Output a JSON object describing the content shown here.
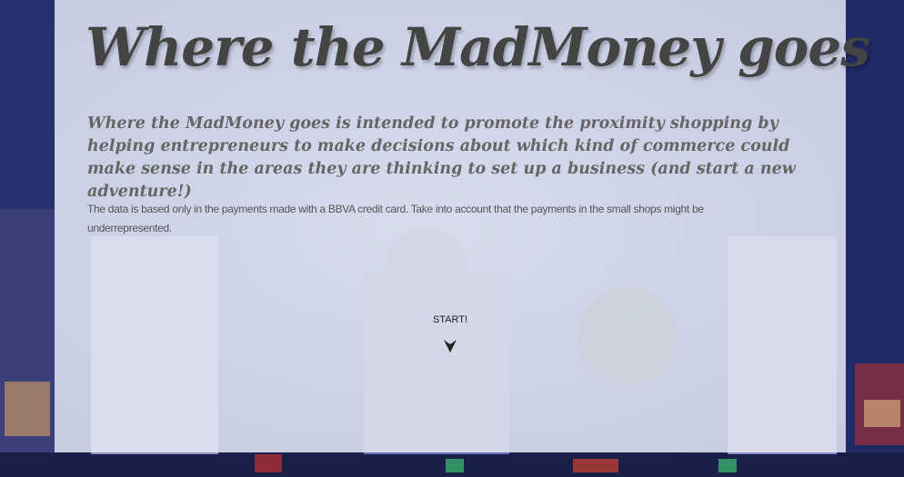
{
  "page": {
    "title": "Where the MadMoney goes",
    "lead": "Where the MadMoney goes is intended to promote the proximity shopping by helping entrepreneurs to make decisions about which kind of commerce could make sense in the areas they are thinking to set up a business (and start a new adventure!)",
    "note": "The data is based only in the payments made with a BBVA credit card. Take into account that the payments in the small shops might be underrepresented.",
    "start_label": "START!"
  },
  "icons": {
    "start_arrow": "arrow-down-icon"
  },
  "colors": {
    "panel": "#eceef6",
    "title": "#444444",
    "lead": "#666666",
    "note": "#555555"
  }
}
